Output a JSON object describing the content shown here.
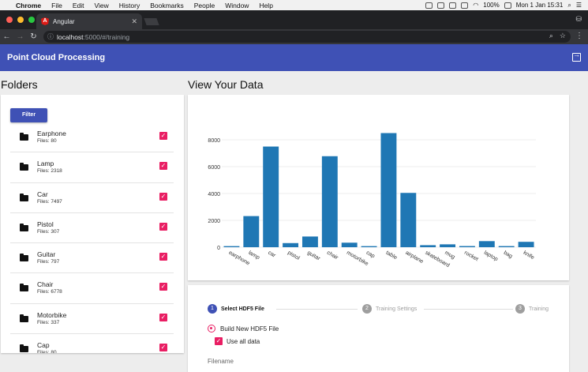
{
  "menubar": {
    "app": "Chrome",
    "items": [
      "File",
      "Edit",
      "View",
      "History",
      "Bookmarks",
      "People",
      "Window",
      "Help"
    ],
    "battery": "100%",
    "clock": "Mon 1 Jan  15:31"
  },
  "browser": {
    "tab_title": "Angular",
    "url_host": "localhost",
    "url_path": ":5000/#/training"
  },
  "app": {
    "title": "Point Cloud Processing"
  },
  "folders": {
    "heading": "Folders",
    "filter_label": "Filter",
    "items": [
      {
        "name": "Earphone",
        "files": "Files: 80"
      },
      {
        "name": "Lamp",
        "files": "Files: 2318"
      },
      {
        "name": "Car",
        "files": "Files: 7497"
      },
      {
        "name": "Pistol",
        "files": "Files: 307"
      },
      {
        "name": "Guitar",
        "files": "Files: 797"
      },
      {
        "name": "Chair",
        "files": "Files: 6778"
      },
      {
        "name": "Motorbike",
        "files": "Files: 337"
      },
      {
        "name": "Cap",
        "files": "Files: 80"
      }
    ]
  },
  "view": {
    "heading": "View Your Data"
  },
  "chart_data": {
    "type": "bar",
    "categories": [
      "earphone",
      "lamp",
      "car",
      "pistol",
      "guitar",
      "chair",
      "motorbike",
      "cap",
      "table",
      "airplane",
      "skateboard",
      "mug",
      "rocket",
      "laptop",
      "bag",
      "knife"
    ],
    "values": [
      80,
      2318,
      7497,
      307,
      797,
      6778,
      337,
      80,
      8500,
      4045,
      152,
      214,
      85,
      452,
      83,
      400
    ],
    "ylim": [
      0,
      9000
    ],
    "yticks": [
      0,
      2000,
      4000,
      6000,
      8000
    ],
    "color": "#1f77b4",
    "grid": true
  },
  "stepper": {
    "steps": [
      {
        "num": "1",
        "label": "Select HDF5 File",
        "active": true
      },
      {
        "num": "2",
        "label": "Training Settings",
        "active": false
      },
      {
        "num": "3",
        "label": "Training",
        "active": false
      }
    ]
  },
  "form": {
    "radio_label": "Build New HDF5 File",
    "checkbox_label": "Use all data",
    "filename_label": "Filename"
  }
}
